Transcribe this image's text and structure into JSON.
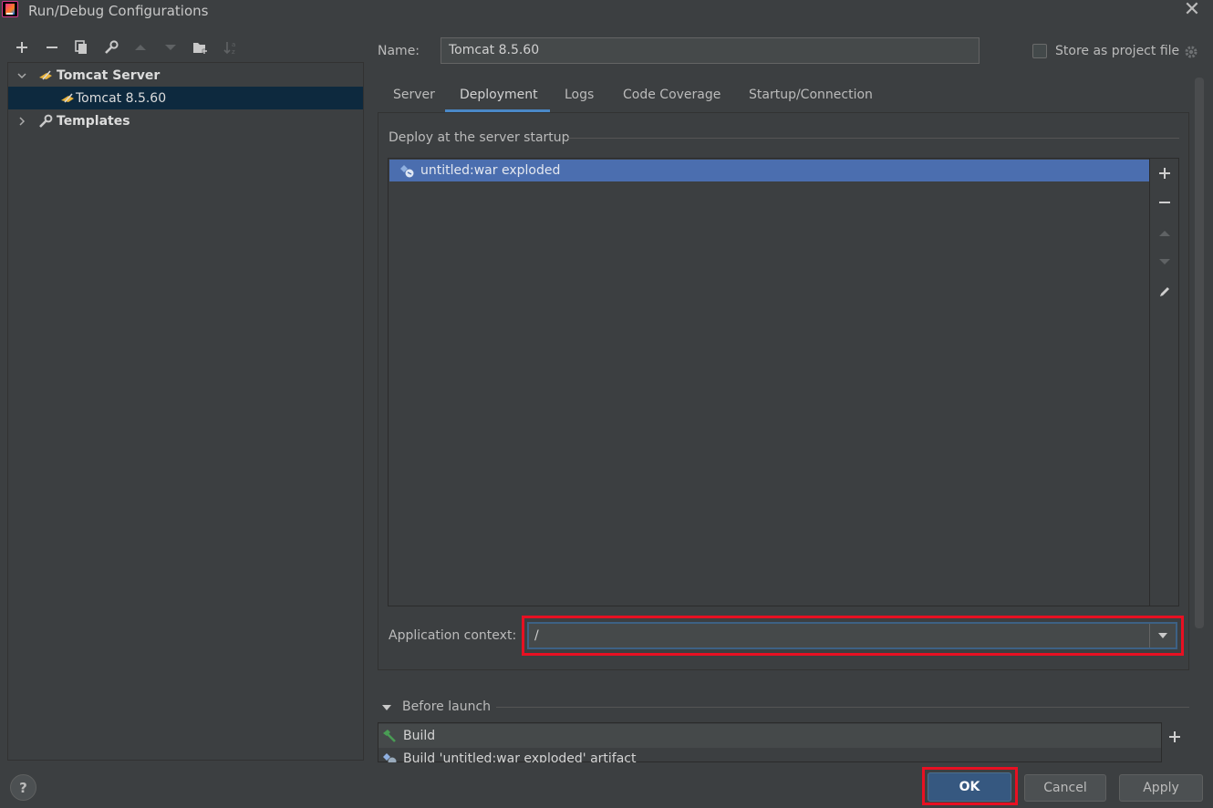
{
  "window": {
    "title": "Run/Debug Configurations",
    "close_glyph": "✕"
  },
  "toolbar": {
    "icons": [
      "add-icon",
      "remove-icon",
      "copy-icon",
      "wrench-icon",
      "move-up-icon",
      "move-down-icon",
      "new-folder-icon",
      "sort-icon"
    ]
  },
  "tree": {
    "items": [
      {
        "label": "Tomcat Server",
        "bold": true,
        "expanded": true
      },
      {
        "label": "Tomcat 8.5.60",
        "selected": true
      },
      {
        "label": "Templates",
        "bold": true,
        "expanded": false
      }
    ]
  },
  "name_field": {
    "label": "Name:",
    "value": "Tomcat 8.5.60"
  },
  "store_project_file": {
    "label": "Store as project file",
    "checked": false
  },
  "tabs": [
    {
      "label": "Server"
    },
    {
      "label": "Deployment",
      "active": true
    },
    {
      "label": "Logs"
    },
    {
      "label": "Code Coverage"
    },
    {
      "label": "Startup/Connection"
    }
  ],
  "deployment": {
    "group_title": "Deploy at the server startup",
    "items": [
      {
        "label": "untitled:war exploded",
        "selected": true
      }
    ],
    "side_buttons": [
      "add-icon",
      "remove-icon",
      "move-up-icon",
      "move-down-icon",
      "edit-icon"
    ]
  },
  "app_context": {
    "label": "Application context:",
    "value": "/"
  },
  "before_launch": {
    "title": "Before launch",
    "items": [
      {
        "label": "Build"
      },
      {
        "label": "Build 'untitled:war exploded' artifact"
      }
    ]
  },
  "buttons": {
    "help": "?",
    "ok": "OK",
    "cancel": "Cancel",
    "apply": "Apply"
  },
  "colors": {
    "background": "#3c3f41",
    "selection": "#4b6eaf",
    "tree_selection": "#0d293e",
    "highlight": "#e81022",
    "ok_button": "#365880"
  }
}
